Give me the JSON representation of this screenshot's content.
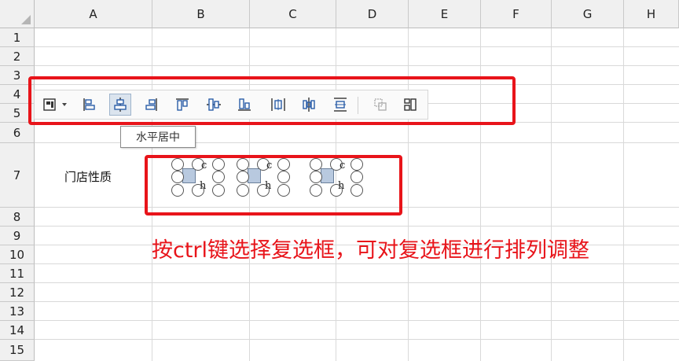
{
  "sheet": {
    "columns": [
      "A",
      "B",
      "C",
      "D",
      "E",
      "F",
      "G",
      "H"
    ],
    "rows": [
      "1",
      "2",
      "3",
      "4",
      "5",
      "6",
      "7",
      "8",
      "9",
      "10",
      "11",
      "12",
      "13",
      "14",
      "15"
    ]
  },
  "toolbar": {
    "buttons": [
      {
        "name": "select-objects",
        "icon": "object-select-icon"
      },
      {
        "name": "align-left",
        "icon": "align-left-icon"
      },
      {
        "name": "align-center-horizontal",
        "icon": "align-center-horizontal-icon",
        "active": true
      },
      {
        "name": "align-right",
        "icon": "align-right-icon"
      },
      {
        "name": "align-top",
        "icon": "align-top-icon"
      },
      {
        "name": "align-middle-vertical",
        "icon": "align-middle-vertical-icon"
      },
      {
        "name": "align-bottom",
        "icon": "align-bottom-icon"
      },
      {
        "name": "distribute-horizontal",
        "icon": "distribute-horizontal-icon"
      },
      {
        "name": "distribute-horizontal-center",
        "icon": "distribute-horizontal-center-icon"
      },
      {
        "name": "distribute-vertical",
        "icon": "distribute-vertical-icon"
      },
      {
        "name": "group",
        "icon": "group-icon",
        "disabled": true
      },
      {
        "name": "arrange",
        "icon": "arrange-icon"
      }
    ],
    "tooltip": "水平居中"
  },
  "cells": {
    "a7": "门店性质"
  },
  "checkboxes": [
    {
      "label_top": "c",
      "label_bottom": "h"
    },
    {
      "label_top": "c",
      "label_bottom": "h"
    },
    {
      "label_top": "c",
      "label_bottom": "h"
    }
  ],
  "annotation": {
    "text": "按ctrl键选择复选框，可对复选框进行排列调整",
    "color": "#e8141a"
  }
}
